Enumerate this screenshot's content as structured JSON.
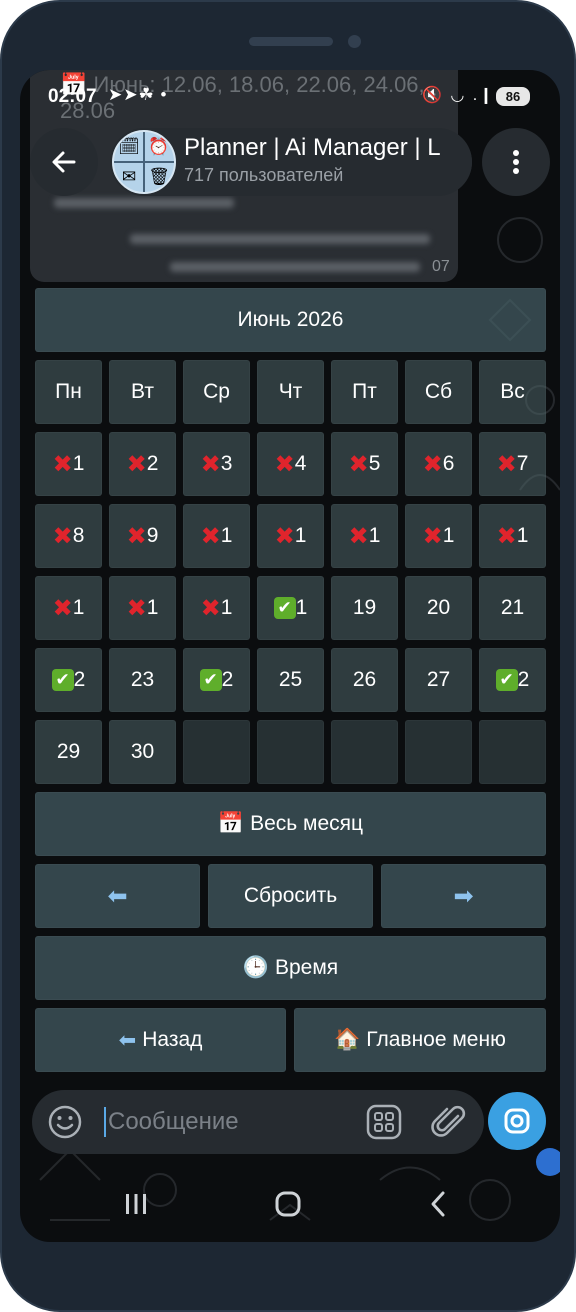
{
  "status_bar": {
    "time": "02:07",
    "left_icons": "➤➤☘ •",
    "right_icons": "🔇 ◡ .❙",
    "battery": "86"
  },
  "ghost_message": {
    "line1": "📅 Июнь: 12.06, 18.06, 22.06, 24.06,",
    "line2": "28.06",
    "time_fragment": "07"
  },
  "header": {
    "title": "Planner | Ai Manager | L",
    "subtitle": "717 пользователей",
    "avatar_icons": [
      "🗓",
      "⏰",
      "✉",
      "🗑"
    ]
  },
  "calendar": {
    "month_label": "Июнь 2026",
    "weekdays": [
      "Пн",
      "Вт",
      "Ср",
      "Чт",
      "Пт",
      "Сб",
      "Вс"
    ],
    "days": [
      {
        "mark": "x",
        "text": "1"
      },
      {
        "mark": "x",
        "text": "2"
      },
      {
        "mark": "x",
        "text": "3"
      },
      {
        "mark": "x",
        "text": "4"
      },
      {
        "mark": "x",
        "text": "5"
      },
      {
        "mark": "x",
        "text": "6"
      },
      {
        "mark": "x",
        "text": "7"
      },
      {
        "mark": "x",
        "text": "8"
      },
      {
        "mark": "x",
        "text": "9"
      },
      {
        "mark": "x",
        "text": "1"
      },
      {
        "mark": "x",
        "text": "1"
      },
      {
        "mark": "x",
        "text": "1"
      },
      {
        "mark": "x",
        "text": "1"
      },
      {
        "mark": "x",
        "text": "1"
      },
      {
        "mark": "x",
        "text": "1"
      },
      {
        "mark": "x",
        "text": "1"
      },
      {
        "mark": "x",
        "text": "1"
      },
      {
        "mark": "ok",
        "text": "1"
      },
      {
        "mark": "",
        "text": "19"
      },
      {
        "mark": "",
        "text": "20"
      },
      {
        "mark": "",
        "text": "21"
      },
      {
        "mark": "ok",
        "text": "2"
      },
      {
        "mark": "",
        "text": "23"
      },
      {
        "mark": "ok",
        "text": "2"
      },
      {
        "mark": "",
        "text": "25"
      },
      {
        "mark": "",
        "text": "26"
      },
      {
        "mark": "",
        "text": "27"
      },
      {
        "mark": "ok",
        "text": "2"
      },
      {
        "mark": "",
        "text": "29"
      },
      {
        "mark": "",
        "text": "30"
      },
      {
        "mark": "",
        "text": ""
      },
      {
        "mark": "",
        "text": ""
      },
      {
        "mark": "",
        "text": ""
      },
      {
        "mark": "",
        "text": ""
      },
      {
        "mark": "",
        "text": ""
      }
    ],
    "x_glyph": "✖",
    "ok_glyph": "✔"
  },
  "buttons": {
    "whole_month_icon": "📅",
    "whole_month": "Весь месяц",
    "prev": "⬅",
    "reset": "Сбросить",
    "next": "➡",
    "time_icon": "🕒",
    "time": "Время",
    "back_icon": "⬅",
    "back": "Назад",
    "main_menu_icon": "🏠",
    "main_menu": "Главное меню"
  },
  "composer": {
    "placeholder": "Сообщение"
  },
  "colors": {
    "accent": "#3aa0e2",
    "key_bg": "#4e6468",
    "cross": "#e0242c",
    "check": "#5fae2b"
  }
}
